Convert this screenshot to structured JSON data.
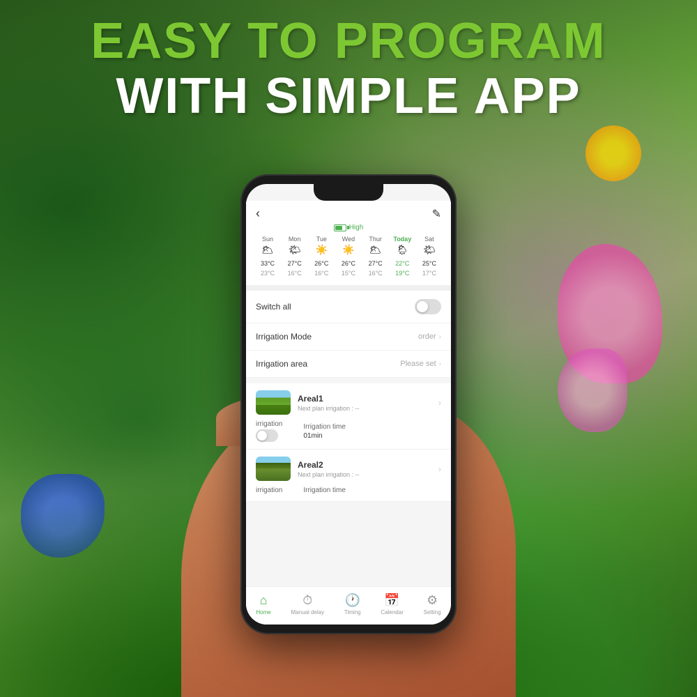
{
  "background": {
    "colors": [
      "#2d5a1b",
      "#6aaa3a",
      "#4a7c2f"
    ]
  },
  "header": {
    "line1": "EASY TO PROGRAM",
    "line2": "WITH SIMPLE APP"
  },
  "phone": {
    "topbar": {
      "back_label": "‹",
      "edit_label": "✎"
    },
    "battery": {
      "label": "High"
    },
    "weather": {
      "days": [
        {
          "name": "Sun",
          "icon": "🌥",
          "high": "33°C",
          "low": "23°C",
          "today": false
        },
        {
          "name": "Mon",
          "icon": "🌤",
          "high": "27°C",
          "low": "16°C",
          "today": false
        },
        {
          "name": "Tue",
          "icon": "☀️",
          "high": "26°C",
          "low": "16°C",
          "today": false
        },
        {
          "name": "Wed",
          "icon": "☀️",
          "high": "26°C",
          "low": "15°C",
          "today": false
        },
        {
          "name": "Thur",
          "icon": "🌥",
          "high": "27°C",
          "low": "16°C",
          "today": false
        },
        {
          "name": "Today",
          "icon": "🌦",
          "high": "22°C",
          "low": "19°C",
          "today": true
        },
        {
          "name": "Sat",
          "icon": "🌤",
          "high": "25°C",
          "low": "17°C",
          "today": false
        }
      ]
    },
    "settings": {
      "switch_all_label": "Switch all",
      "irrigation_mode_label": "Irrigation Mode",
      "irrigation_mode_value": "order",
      "irrigation_area_label": "Irrigation area",
      "irrigation_area_value": "Please set"
    },
    "areas": [
      {
        "name": "Areal1",
        "next_plan": "Next plan irrigation : --",
        "irrigation_label": "irrigation",
        "irrigation_time_label": "Irrigation time",
        "irrigation_time_value": "01min"
      },
      {
        "name": "Areal2",
        "next_plan": "Next plan irrigation : --",
        "irrigation_label": "irrigation",
        "irrigation_time_label": "Irrigation time",
        "irrigation_time_value": ""
      }
    ],
    "bottom_nav": [
      {
        "icon": "⌂",
        "label": "Home",
        "active": true
      },
      {
        "icon": "⏱",
        "label": "Manual delay",
        "active": false
      },
      {
        "icon": "🕐",
        "label": "Timing",
        "active": false
      },
      {
        "icon": "📅",
        "label": "Calendar",
        "active": false
      },
      {
        "icon": "⚙",
        "label": "Setting",
        "active": false
      }
    ]
  }
}
